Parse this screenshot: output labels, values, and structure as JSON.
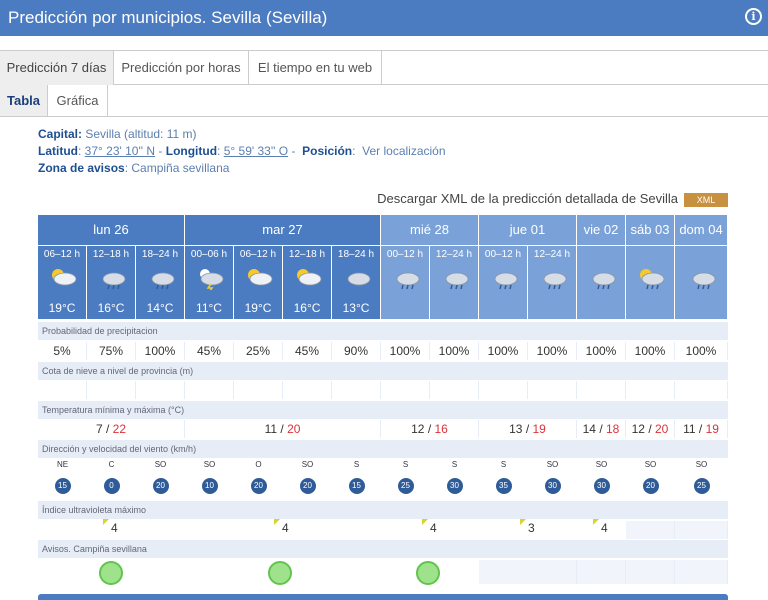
{
  "title": "Predicción por municipios. Sevilla (Sevilla)",
  "tabs": [
    "Predicción 7 días",
    "Predicción por horas",
    "El tiempo en tu web"
  ],
  "subtabs": [
    "Tabla",
    "Gráfica"
  ],
  "meta": {
    "capital_label": "Capital:",
    "capital_value": " Sevilla (altitud: 11 m)",
    "lat_label": "Latitud",
    "lat_value": "37° 23' 10'' N",
    "lon_label": "Longitud",
    "lon_value": "5° 59' 33'' O",
    "pos_label": "Posición",
    "pos_value": "Ver localización",
    "zona_label": "Zona de avisos",
    "zona_value": ": Campiña sevillana"
  },
  "xml_text": "Descargar XML de la predicción detallada de Sevilla",
  "xml_badge": "XML",
  "days": [
    "lun 26",
    "mar 27",
    "mié 28",
    "jue 01",
    "vie 02",
    "sáb 03",
    "dom 04"
  ],
  "periods": [
    "06–12 h",
    "12–18 h",
    "18–24 h",
    "00–06 h",
    "06–12 h",
    "12–18 h",
    "18–24 h",
    "00–12 h",
    "12–24 h",
    "00–12 h",
    "12–24 h"
  ],
  "temps": [
    "19°C",
    "16°C",
    "14°C",
    "11°C",
    "19°C",
    "16°C",
    "13°C"
  ],
  "rows": {
    "precip_label": "Probabilidad de precipitacion",
    "precip": [
      "5%",
      "75%",
      "100%",
      "45%",
      "25%",
      "45%",
      "90%",
      "100%",
      "100%",
      "100%",
      "100%",
      "100%",
      "100%",
      "100%"
    ],
    "snow_label": "Cota de nieve a nivel de provincia (m)",
    "temp_label": "Temperatura mínima y máxima (°C)",
    "minmax": [
      [
        "7",
        "22"
      ],
      [
        "11",
        "20"
      ],
      [
        "12",
        "16"
      ],
      [
        "13",
        "19"
      ],
      [
        "14",
        "18"
      ],
      [
        "12",
        "20"
      ],
      [
        "11",
        "19"
      ]
    ],
    "wind_label": "Dirección y velocidad del viento (km/h)",
    "wind": [
      [
        "NE",
        "15"
      ],
      [
        "C",
        "0"
      ],
      [
        "SO",
        "20"
      ],
      [
        "SO",
        "10"
      ],
      [
        "O",
        "20"
      ],
      [
        "SO",
        "20"
      ],
      [
        "S",
        "15"
      ],
      [
        "S",
        "25"
      ],
      [
        "S",
        "30"
      ],
      [
        "S",
        "35"
      ],
      [
        "SO",
        "30"
      ],
      [
        "SO",
        "30"
      ],
      [
        "SO",
        "20"
      ],
      [
        "SO",
        "25"
      ]
    ],
    "uv_label": "Índice ultravioleta máximo",
    "uv": [
      "4",
      "4",
      "4",
      "3",
      "4"
    ],
    "aviso_label": "Avisos. Campiña sevillana"
  },
  "colors": {
    "header": "#4b7cc1",
    "header_light": "#7aa2d8",
    "row_label": "#e6edf6",
    "aviso": "#9fe28c",
    "max_temp": "#d9343a"
  }
}
